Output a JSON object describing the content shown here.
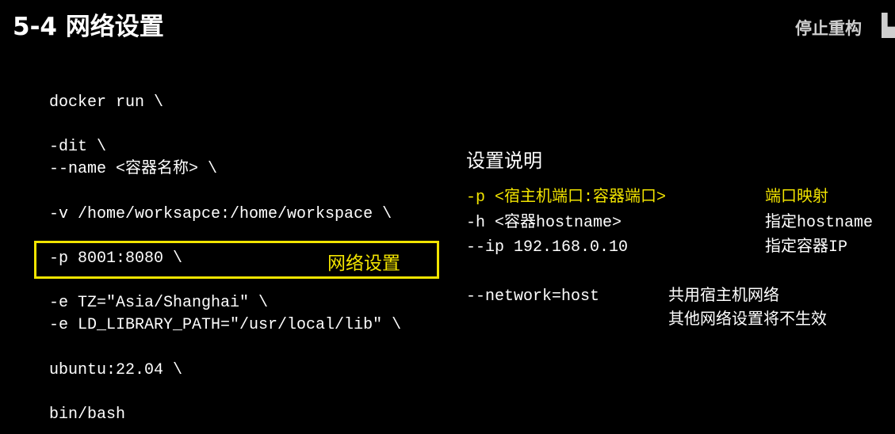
{
  "title": "5-4 网络设置",
  "stop_button": "停止重构",
  "code_lines": [
    "docker run \\",
    "-dit \\",
    "--name <容器名称> \\",
    "-v /home/worksapce:/home/workspace \\",
    "-p 8001:8080 \\",
    "-e TZ=\"Asia/Shanghai\" \\",
    "-e LD_LIBRARY_PATH=\"/usr/local/lib\" \\",
    "ubuntu:22.04 \\",
    "bin/bash"
  ],
  "highlight_label": "网络设置",
  "explain": {
    "heading": "设置说明",
    "rows": [
      {
        "option": "-p <宿主机端口:容器端口>",
        "desc": "端口映射"
      },
      {
        "option": "-h <容器hostname>",
        "desc": "指定hostname"
      },
      {
        "option": "--ip 192.168.0.10",
        "desc": "指定容器IP"
      }
    ],
    "network": {
      "option": "--network=host",
      "desc1": "共用宿主机网络",
      "desc2": "其他网络设置将不生效"
    }
  },
  "colors": {
    "highlight": "#f2e400"
  }
}
